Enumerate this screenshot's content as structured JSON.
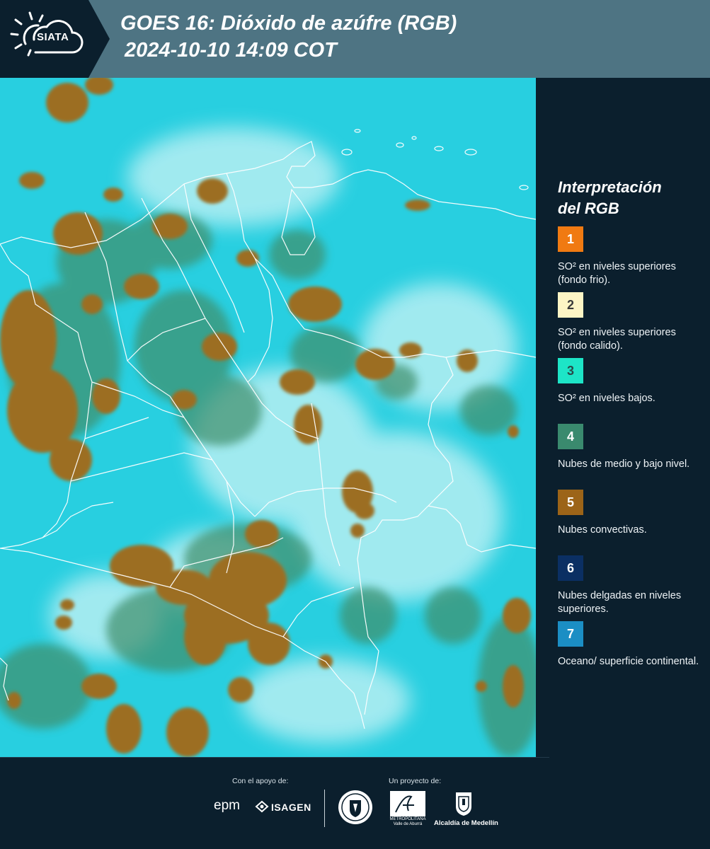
{
  "header": {
    "logo_text": "SIATA",
    "title_line1": "GOES 16: Dióxido de azúfre (RGB)",
    "title_line2": "2024-10-10 14:09 COT"
  },
  "legend": {
    "title_line1": "Interpretación",
    "title_line2": "del RGB",
    "items": [
      {
        "number": "1",
        "color": "#f07a12",
        "text_color": "#ffffff",
        "label": "SO² en niveles superiores (fondo frio)."
      },
      {
        "number": "2",
        "color": "#fdf5c5",
        "text_color": "#3a3a3a",
        "label": "SO² en niveles superiores (fondo calido)."
      },
      {
        "number": "3",
        "color": "#1de5c7",
        "text_color": "#2a4a4a",
        "label": "SO² en niveles bajos."
      },
      {
        "number": "4",
        "color": "#3a8a6e",
        "text_color": "#ffffff",
        "label": "Nubes de medio y bajo nivel."
      },
      {
        "number": "5",
        "color": "#9c6418",
        "text_color": "#ffffff",
        "label": "Nubes convectivas."
      },
      {
        "number": "6",
        "color": "#0b2f63",
        "text_color": "#ffffff",
        "label": "Nubes delgadas en niveles superiores."
      },
      {
        "number": "7",
        "color": "#1b8ec4",
        "text_color": "#ffffff",
        "label": "Oceano/ superficie continental."
      }
    ]
  },
  "footer": {
    "support_label": "Con el apoyo de:",
    "project_label": "Un proyecto de:",
    "sponsor1": "epm",
    "sponsor2": "ISAGEN",
    "area_name": "METROPOLITANA Valle de Aburrá",
    "alcaldia": "Alcaldía de Medellín"
  },
  "map": {
    "colors": {
      "sky": "#28cfe0",
      "haze": "#c9f3f5",
      "convective": "#9c6e24",
      "midcloud": "#3f8e6a",
      "borders": "#ffffff"
    }
  }
}
